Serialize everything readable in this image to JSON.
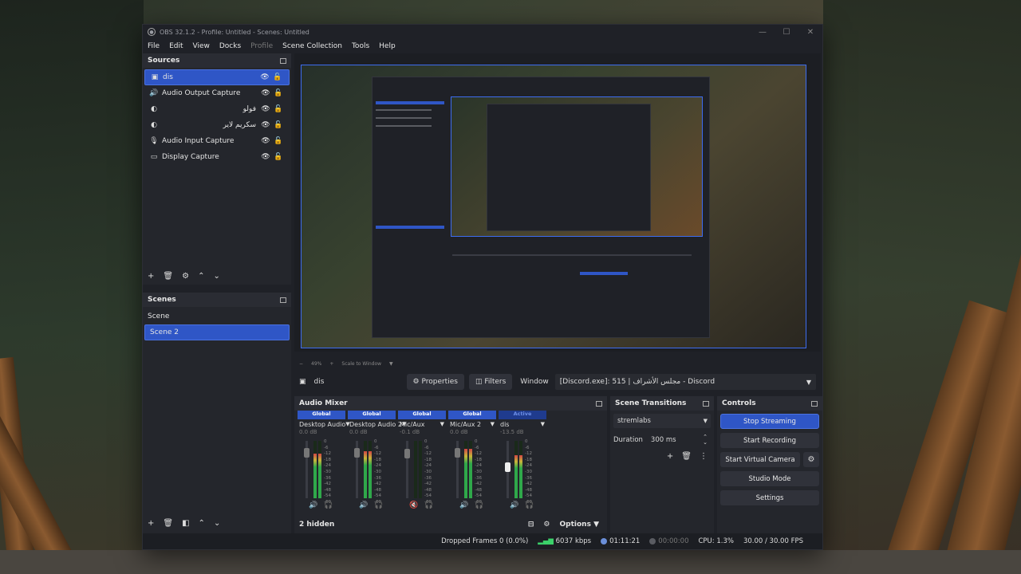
{
  "window": {
    "title": "OBS 32.1.2 - Profile: Untitled - Scenes: Untitled",
    "controls": [
      "—",
      "☐",
      "✕"
    ]
  },
  "menu": [
    "File",
    "Edit",
    "View",
    "Docks",
    "Profile",
    "Scene Collection",
    "Tools",
    "Help"
  ],
  "sources": {
    "title": "Sources",
    "items": [
      {
        "label": "dis",
        "icon": "window-capture-icon",
        "glyph": "▣",
        "selected": true,
        "rtl": false
      },
      {
        "label": "Audio Output Capture",
        "icon": "speaker-icon",
        "glyph": "🔊",
        "selected": false,
        "rtl": false
      },
      {
        "label": "فولو",
        "icon": "browser-icon",
        "glyph": "◐",
        "selected": false,
        "rtl": true
      },
      {
        "label": "سكريم لاير",
        "icon": "browser-icon",
        "glyph": "◐",
        "selected": false,
        "rtl": true
      },
      {
        "label": "Audio Input Capture",
        "icon": "microphone-icon",
        "glyph": "🎙",
        "selected": false,
        "rtl": false
      },
      {
        "label": "Display Capture",
        "icon": "monitor-icon",
        "glyph": "▭",
        "selected": false,
        "rtl": false
      }
    ]
  },
  "scenes": {
    "title": "Scenes",
    "items": [
      {
        "label": "Scene",
        "selected": false
      },
      {
        "label": "Scene 2",
        "selected": true
      }
    ]
  },
  "preview": {
    "zoom": "49%",
    "scale_mode": "Scale to Window"
  },
  "context": {
    "source_name": "dis",
    "properties": "Properties",
    "filters": "Filters",
    "window_label": "Window",
    "window_value": "[Discord.exe]: 515 | مجلس الأشراف - Discord"
  },
  "mixer": {
    "title": "Audio Mixer",
    "channels": [
      {
        "badge": "Global",
        "name": "Desktop Audio",
        "db": "0.0 dB",
        "level": 0.78,
        "fader": 0.85,
        "monitor_on": true,
        "muted": false,
        "active": false
      },
      {
        "badge": "Global",
        "name": "Desktop Audio 2",
        "db": "0.0 dB",
        "level": 0.82,
        "fader": 0.85,
        "monitor_on": false,
        "muted": false,
        "active": false
      },
      {
        "badge": "Global",
        "name": "Mic/Aux",
        "db": "-0.1 dB",
        "level": 0.0,
        "fader": 0.84,
        "monitor_on": false,
        "muted": true,
        "active": false
      },
      {
        "badge": "Global",
        "name": "Mic/Aux 2",
        "db": "0.0 dB",
        "level": 0.86,
        "fader": 0.85,
        "monitor_on": false,
        "muted": false,
        "active": false
      },
      {
        "badge": "Active",
        "name": "dis",
        "db": "-13.5 dB",
        "level": 0.75,
        "fader": 0.55,
        "monitor_on": false,
        "muted": false,
        "active": true
      }
    ],
    "scale": [
      "0",
      "-6",
      "-12",
      "-18",
      "-24",
      "-30",
      "-36",
      "-42",
      "-48",
      "-54",
      "-60"
    ],
    "hidden": "2 hidden",
    "options": "Options"
  },
  "transitions": {
    "title": "Scene Transitions",
    "selected": "stremlabs",
    "duration_label": "Duration",
    "duration_value": "300 ms"
  },
  "controls": {
    "title": "Controls",
    "buttons": [
      "Stop Streaming",
      "Start Recording",
      "Start Virtual Camera",
      "Studio Mode",
      "Settings"
    ]
  },
  "status": {
    "dropped": "Dropped Frames 0 (0.0%)",
    "kbps": "6037 kbps",
    "stream_time": "01:11:21",
    "rec_time": "00:00:00",
    "cpu": "CPU: 1.3%",
    "fps": "30.00 / 30.00 FPS"
  }
}
